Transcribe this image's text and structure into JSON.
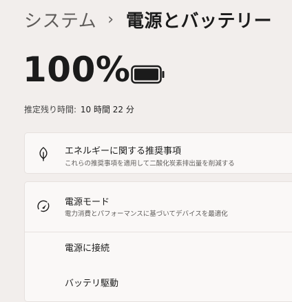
{
  "header": {
    "parent": "システム",
    "separator": "›",
    "current": "電源とバッテリー"
  },
  "battery": {
    "percent_text": "100%",
    "level": 1.0,
    "estimate_label": "推定残り時間:",
    "estimate_value": "10 時間 22 分"
  },
  "energy_recommendations": {
    "icon": "leaf-icon",
    "title": "エネルギーに関する推奨事項",
    "subtitle": "これらの推奨事項を適用して二酸化炭素排出量を削減する"
  },
  "power_mode": {
    "icon": "power-mode-icon",
    "title": "電源モード",
    "subtitle": "電力消費とパフォーマンスに基づいてデバイスを最適化",
    "options": [
      "電源に接続",
      "バッテリ駆動"
    ]
  }
}
